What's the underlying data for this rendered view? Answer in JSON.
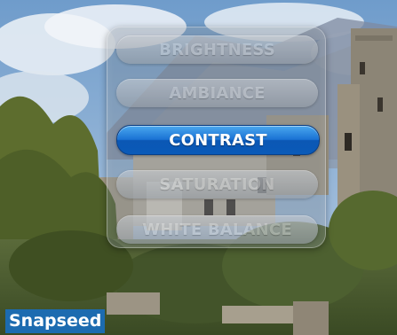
{
  "adjust_menu": {
    "items": [
      {
        "label": "BRIGHTNESS"
      },
      {
        "label": "AMBIANCE"
      },
      {
        "label": "CONTRAST",
        "selected": true
      },
      {
        "label": "SATURATION"
      },
      {
        "label": "WHITE BALANCE"
      }
    ],
    "selected_color": "#1a72d4"
  },
  "watermark": {
    "label": "Snapseed",
    "color": "#1c6bb0"
  }
}
